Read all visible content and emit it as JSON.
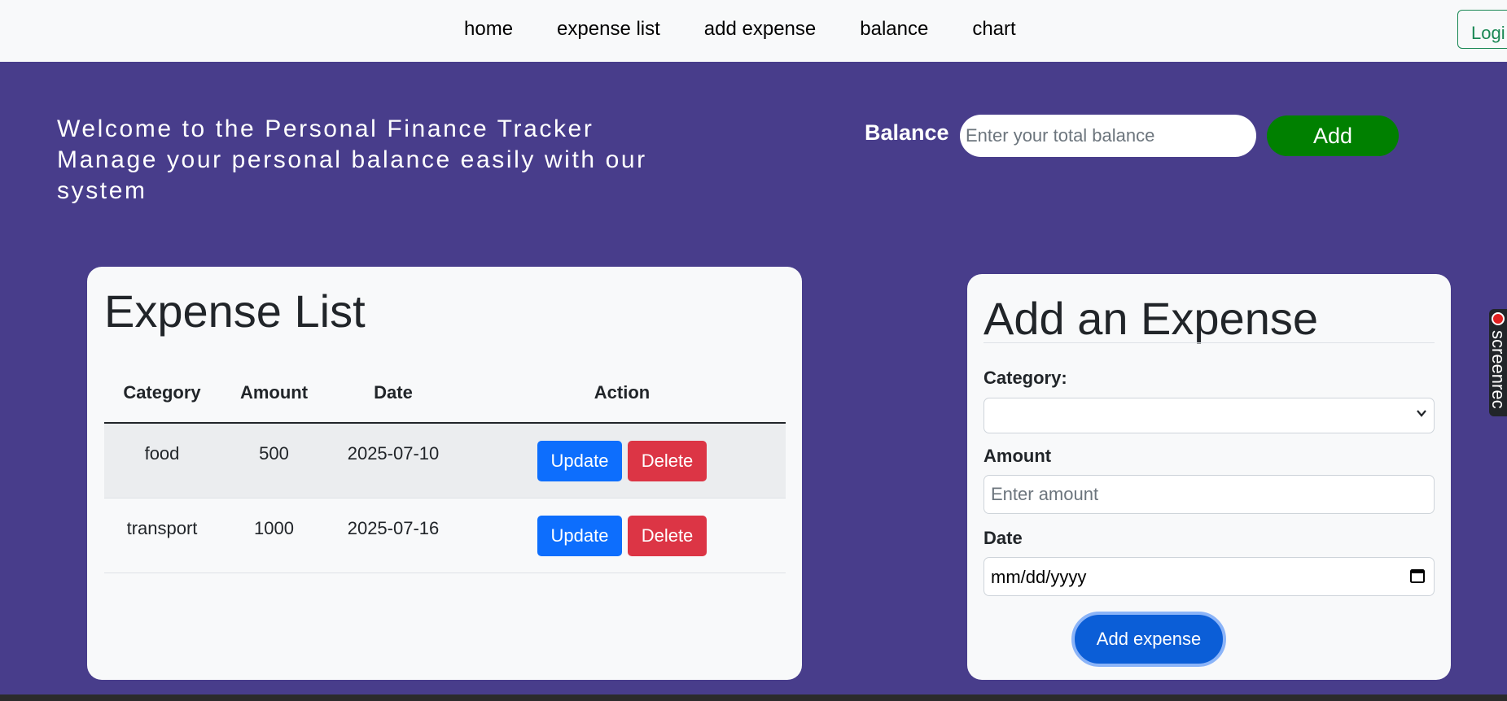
{
  "nav": {
    "links": [
      "home",
      "expense list",
      "add expense",
      "balance",
      "chart"
    ],
    "login_label": "Logi"
  },
  "welcome": {
    "line1": "Welcome to the Personal Finance Tracker",
    "line2": "Manage your personal balance easily with our",
    "line3": "system"
  },
  "balance": {
    "label": "Balance",
    "input_placeholder": "Enter your total balance",
    "input_value": "",
    "add_label": "Add"
  },
  "expense_list": {
    "title": "Expense List",
    "columns": [
      "Category",
      "Amount",
      "Date",
      "Action"
    ],
    "rows": [
      {
        "category": "food",
        "amount": "500",
        "date": "2025-07-10"
      },
      {
        "category": "transport",
        "amount": "1000",
        "date": "2025-07-16"
      }
    ],
    "update_label": "Update",
    "delete_label": "Delete"
  },
  "add_expense": {
    "title": "Add an Expense",
    "category_label": "Category:",
    "category_value": "",
    "amount_label": "Amount",
    "amount_placeholder": "Enter amount",
    "date_label": "Date",
    "date_placeholder": "mm/dd/yyyy",
    "submit_label": "Add expense"
  },
  "screenrec": {
    "label": "screenrec"
  },
  "colors": {
    "background": "#483d8b",
    "navbar": "#f8f9fa",
    "balance_add": "#008000",
    "update": "#0d6efd",
    "delete": "#dc3545",
    "login_outline": "#198754"
  },
  "icons": [
    "chevron-down-icon",
    "calendar-icon",
    "record-dot-icon"
  ]
}
